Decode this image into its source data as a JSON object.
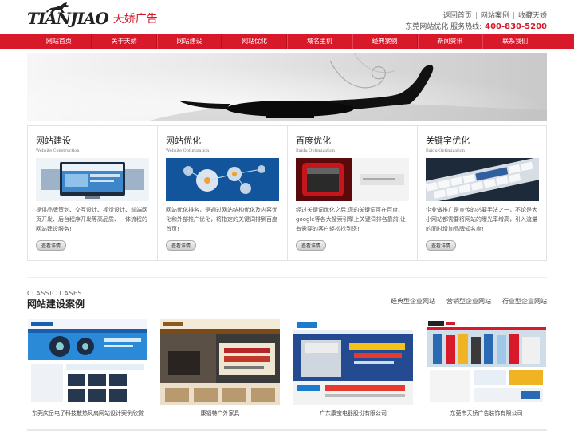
{
  "header": {
    "logo_text": "TIANJIAO",
    "logo_cn": "天娇广告",
    "links": [
      "返回首页",
      "网站案例",
      "收藏天娇"
    ],
    "hotline_label": "东莞网站优化 服务热线:",
    "hotline_number": "400-830-5200"
  },
  "nav": {
    "items": [
      "网站首页",
      "关于天娇",
      "网站建设",
      "网站优化",
      "域名主机",
      "经典案例",
      "新闻资讯",
      "联系我们"
    ]
  },
  "services": [
    {
      "title": "网站建设",
      "subtitle": "Website Construction",
      "desc": "提供品牌策划、交互设计、视觉设计、前端网页开发、后台程序开发等高品质、一体流程的网站建设服务!",
      "button": "查看详情"
    },
    {
      "title": "网站优化",
      "subtitle": "Website Optimization",
      "desc": "网站优化排名，是通过网站结构优化及内容优化和外部推广优化，将指定的关键词排到百度首页!",
      "button": "查看详情"
    },
    {
      "title": "百度优化",
      "subtitle": "Baidu Optimization",
      "desc": "经过关键词优化之后,您的关键词可在百度、google等各大搜索引擎上关键词排名靠前,让有需要的客户轻松找到您!",
      "button": "查看详情"
    },
    {
      "title": "关键字优化",
      "subtitle": "Baidu Optimization",
      "desc": "企业做推广是宣传的必要手法之一，不论是大小网站都需要将网站的曝光率增高，引入流量的同时增加品牌知名度!",
      "button": "查看详情"
    }
  ],
  "cases": {
    "en": "CLASSIC CASES",
    "title": "网站建设案例",
    "tabs": [
      "经典型企业网站",
      "营销型企业网站",
      "行业型企业网站"
    ],
    "items": [
      {
        "caption": "东莞庆岳电子科技散热风扇网站设计案例欣赏"
      },
      {
        "caption": "康福特户外家具"
      },
      {
        "caption": "广东康宝电器股份有限公司"
      },
      {
        "caption": "东莞市天娇广告装饰有限公司"
      }
    ]
  },
  "colors": {
    "brand_red": "#d7192a"
  }
}
